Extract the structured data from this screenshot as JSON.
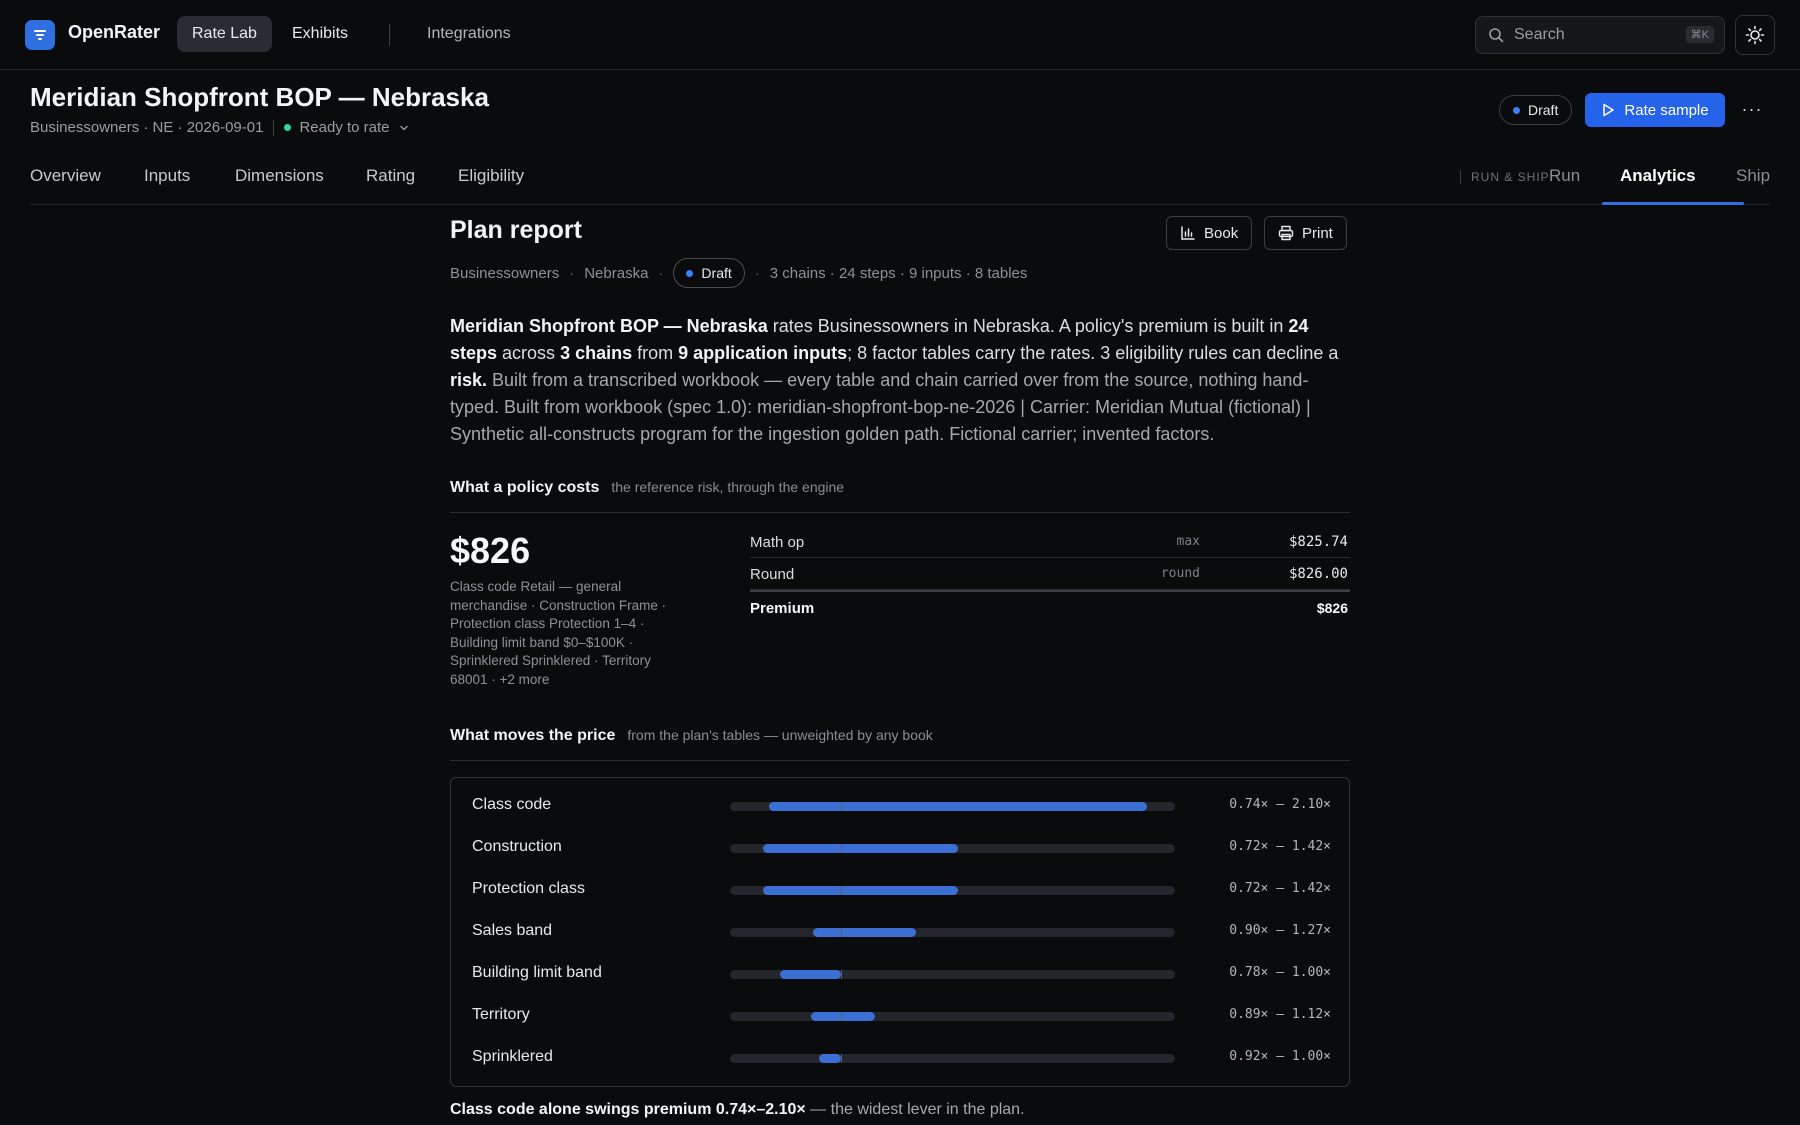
{
  "topbar": {
    "brand": "OpenRater",
    "nav": [
      "Rate Lab",
      "Exhibits",
      "Integrations"
    ],
    "search_placeholder": "Search",
    "search_shortcut": "⌘K"
  },
  "header": {
    "title": "Meridian Shopfront BOP — Nebraska",
    "subtitle": "Businessowners · NE · 2026-09-01",
    "status": "Ready to rate",
    "badge": "Draft",
    "primary_action": "Rate sample",
    "more": "···"
  },
  "tabs": {
    "left": [
      "Overview",
      "Inputs",
      "Dimensions",
      "Rating",
      "Eligibility"
    ],
    "group_label": "RUN & SHIP",
    "right": [
      "Run",
      "Analytics",
      "Ship"
    ],
    "active": "Analytics"
  },
  "report": {
    "title": "Plan report",
    "book_button": "Book",
    "print_button": "Print",
    "meta": {
      "line": "Businessowners",
      "state": "Nebraska",
      "badge": "Draft",
      "stats": "3 chains · 24 steps · 9 inputs · 8 tables"
    },
    "description": {
      "plan_name": "Meridian Shopfront BOP — Nebraska",
      "t1": " rates Businessowners in Nebraska. A policy's premium is built in ",
      "steps": "24 steps",
      "t2": " across ",
      "chains": "3 chains",
      "t3": " from ",
      "inputs": "9 application inputs",
      "t4": "; 8 factor tables carry the rates. 3 eligibility rules can decline a ",
      "risk": "risk.",
      "t5": " Built from a transcribed workbook — every table and chain carried over from the source, nothing hand-typed. Built from workbook (spec 1.0): meridian-shopfront-bop-ne-2026 | Carrier: Meridian Mutual (fictional) | Synthetic all-constructs program for the ingestion golden path. Fictional carrier; invented factors."
    },
    "cost": {
      "heading": "What a policy costs",
      "subheading": "the reference risk, through the engine",
      "premium": "$826",
      "risk_desc": "Class code Retail — general merchandise · Construction Frame · Protection class Protection 1–4 · Building limit band $0–$100K · Sprinklered Sprinklered · Territory 68001 · +2 more",
      "rows": [
        {
          "label": "Math op",
          "op": "max",
          "value": "$825.74"
        },
        {
          "label": "Round",
          "op": "round",
          "value": "$826.00"
        }
      ],
      "total": {
        "label": "Premium",
        "value": "$826"
      }
    },
    "moves": {
      "heading": "What moves the price",
      "subheading": "from the plan's tables — unweighted by any book",
      "factors": [
        {
          "name": "Class code",
          "min": 0.74,
          "max": 2.1,
          "range": "0.74× – 2.10×"
        },
        {
          "name": "Construction",
          "min": 0.72,
          "max": 1.42,
          "range": "0.72× – 1.42×"
        },
        {
          "name": "Protection class",
          "min": 0.72,
          "max": 1.42,
          "range": "0.72× – 1.42×"
        },
        {
          "name": "Sales band",
          "min": 0.9,
          "max": 1.27,
          "range": "0.90× – 1.27×"
        },
        {
          "name": "Building limit band",
          "min": 0.78,
          "max": 1.0,
          "range": "0.78× – 1.00×"
        },
        {
          "name": "Territory",
          "min": 0.89,
          "max": 1.12,
          "range": "0.89× – 1.12×"
        },
        {
          "name": "Sprinklered",
          "min": 0.92,
          "max": 1.0,
          "range": "0.92× – 1.00×"
        }
      ],
      "footnote_bold": "Class code alone swings premium 0.74×–2.10×",
      "footnote_rest": " — the widest lever in the plan."
    }
  },
  "colors": {
    "accent": "#2563eb",
    "bar": "#3b6fd4",
    "ready_dot": "#34d399",
    "draft_dot": "#3b82f6"
  }
}
